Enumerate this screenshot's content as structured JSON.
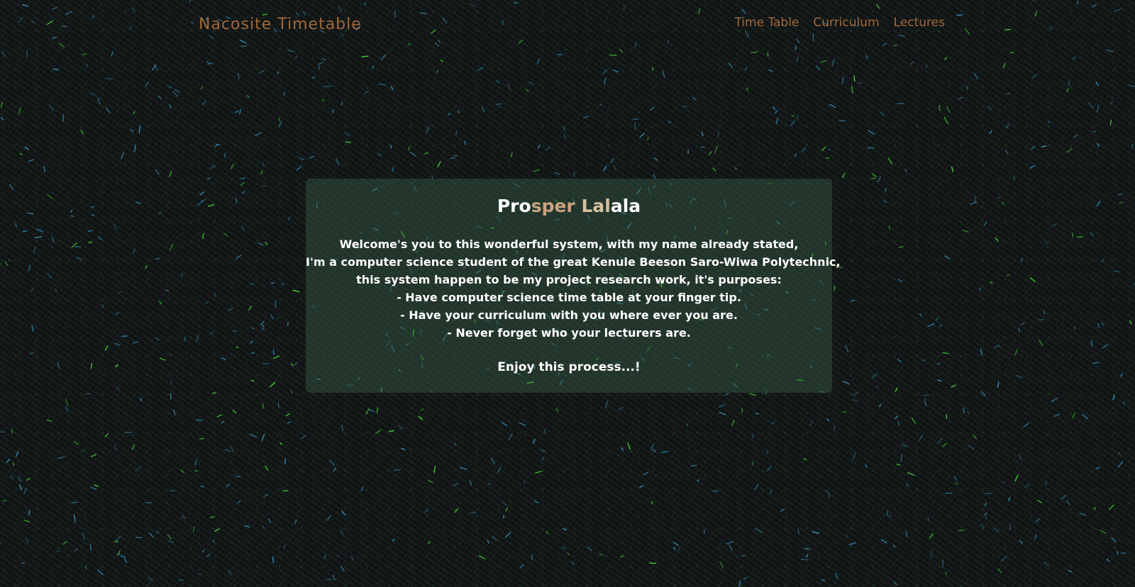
{
  "header": {
    "brand": "Nacosite Timetable",
    "nav": [
      {
        "label": "Time Table"
      },
      {
        "label": "Curriculum"
      },
      {
        "label": "Lectures"
      }
    ]
  },
  "card": {
    "name_parts": [
      "Pro",
      "sper",
      " Lal",
      "ala"
    ],
    "lines": [
      "Welcome's you to this wonderful system, with my name already stated,",
      "I'm a computer science student of the great Kenule Beeson Saro-Wiwa Polytechnic,",
      "this system happen to be my project research work, it's purposes:",
      "- Have computer science time table at your finger tip.",
      "- Have your curriculum with you where ever you are.",
      "- Never forget who your lecturers are."
    ],
    "closing": "Enjoy this process...!"
  },
  "colors": {
    "brand": "#a0683a",
    "nav_link": "#a0683a",
    "card_bg": "rgba(60, 95, 75, 0.42)",
    "text": "#ffffff"
  }
}
